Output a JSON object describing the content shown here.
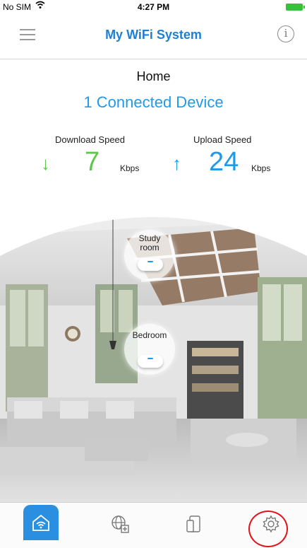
{
  "status_bar": {
    "carrier": "No SIM",
    "time": "4:27 PM"
  },
  "header": {
    "title": "My WiFi System",
    "menu_icon": "hamburger-menu-icon",
    "info_icon": "info-icon",
    "info_glyph": "i"
  },
  "network": {
    "location": "Home",
    "connected_devices": "1 Connected Device"
  },
  "speeds": {
    "download_label": "Download Speed",
    "download_value": "7",
    "download_unit": "Kbps",
    "upload_label": "Upload Speed",
    "upload_value": "24",
    "upload_unit": "Kbps",
    "download_arrow": "↓",
    "upload_arrow": "↑"
  },
  "nodes": [
    {
      "label": "Study room"
    },
    {
      "label": "Bedroom"
    }
  ],
  "tab_bar": {
    "tabs": [
      {
        "icon": "home-wifi-icon",
        "active": true
      },
      {
        "icon": "globe-add-icon",
        "active": false
      },
      {
        "icon": "devices-icon",
        "active": false
      },
      {
        "icon": "gear-icon",
        "active": false,
        "highlighted": true
      }
    ]
  },
  "colors": {
    "accent_blue": "#1e9be8",
    "download_green": "#5cc84a",
    "highlight_red": "#e0121b",
    "battery_green": "#35c23b"
  }
}
